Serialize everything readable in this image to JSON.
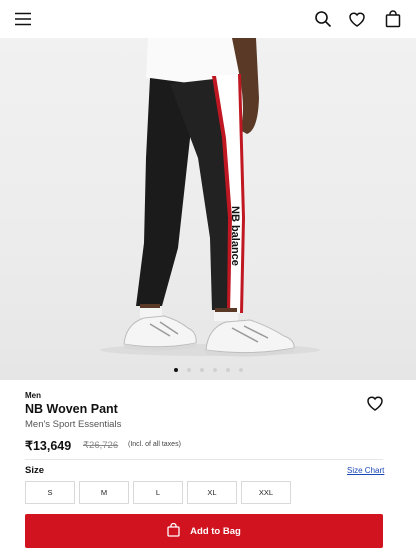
{
  "header": {
    "icons": [
      "menu-icon",
      "search-icon",
      "heart-icon",
      "bag-icon"
    ]
  },
  "gallery": {
    "image_brand_text": "NB balance",
    "dot_count": 6,
    "active_dot": 1
  },
  "product": {
    "category": "Men",
    "name": "NB Woven Pant",
    "collection": "Men's Sport Essentials",
    "price": "₹13,649",
    "mrp": "₹26,726",
    "tax_note": "(Incl. of all taxes)"
  },
  "size_section": {
    "label": "Size",
    "chart_link": "Size Chart",
    "options": [
      "S",
      "M",
      "L",
      "XL",
      "XXL"
    ]
  },
  "cta": {
    "add_to_bag": "Add to Bag"
  },
  "colors": {
    "accent": "#d0131f",
    "link": "#1a48b6"
  }
}
